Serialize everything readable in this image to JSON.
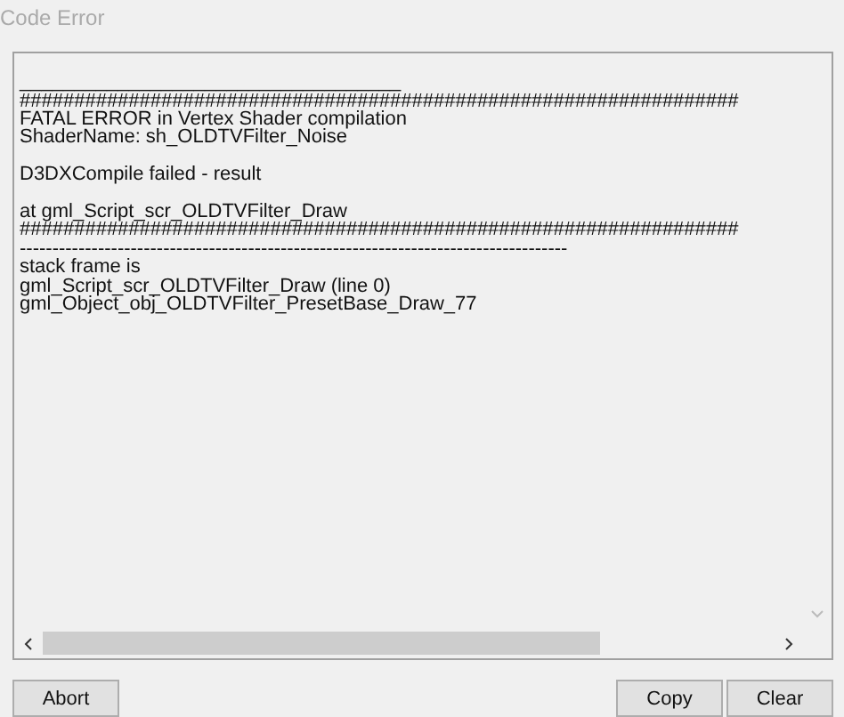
{
  "window": {
    "title": "Code Error"
  },
  "log": {
    "paragraphs": [
      [
        "___________________________________",
        "##################################################################",
        "FATAL ERROR in Vertex Shader compilation",
        "ShaderName: sh_OLDTVFilter_Noise"
      ],
      [
        "D3DXCompile failed - result"
      ],
      [
        "at gml_Script_scr_OLDTVFilter_Draw",
        "##################################################################",
        "------------------------------------------------------------------------------------",
        "stack frame is",
        "gml_Script_scr_OLDTVFilter_Draw (line 0)",
        "gml_Object_obj_OLDTVFilter_PresetBase_Draw_77"
      ]
    ]
  },
  "buttons": [
    {
      "label": "Abort",
      "kind": "left"
    },
    {
      "label": "Copy",
      "kind": "right"
    },
    {
      "label": "Clear",
      "kind": "right"
    }
  ]
}
